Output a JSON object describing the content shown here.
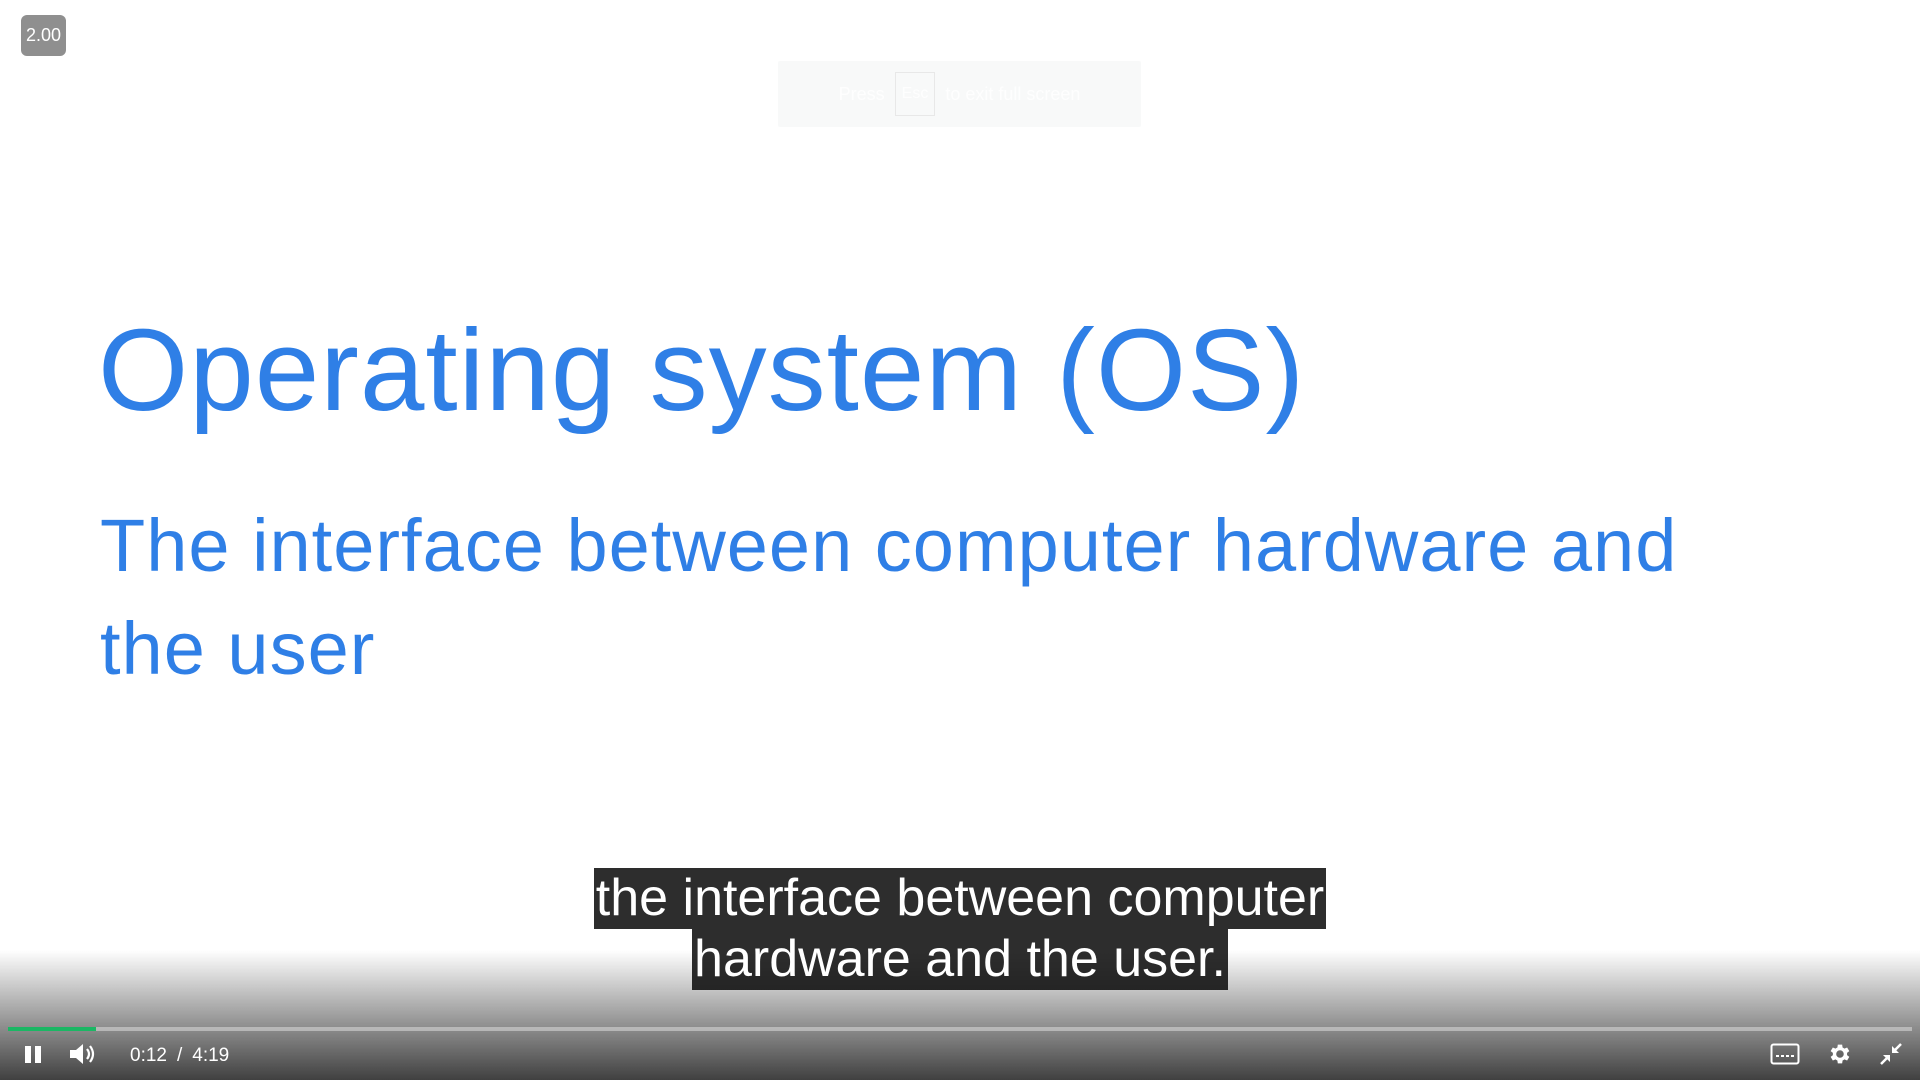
{
  "player": {
    "speed_badge": "2.00",
    "fullscreen_hint": {
      "prefix": "Press",
      "key": "Esc",
      "suffix": "to exit full screen"
    }
  },
  "slide": {
    "title": "Operating system (OS)",
    "subtitle": "The interface between computer hardware and the user"
  },
  "captions": {
    "line1": "the interface between computer",
    "line2": "hardware and the user."
  },
  "controls": {
    "current_time": "0:12",
    "separator": "/",
    "duration": "4:19",
    "progress_fraction": 0.046,
    "accent_color": "#1bb764",
    "icons": [
      "pause-icon",
      "volume-icon",
      "captions-icon",
      "settings-icon",
      "exit-fullscreen-icon"
    ]
  }
}
